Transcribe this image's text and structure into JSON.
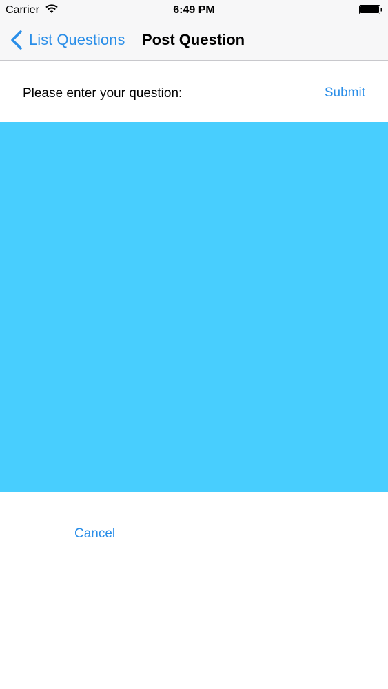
{
  "status_bar": {
    "carrier": "Carrier",
    "time": "6:49 PM",
    "icons": [
      "wifi-icon",
      "battery-icon"
    ]
  },
  "nav_bar": {
    "back_label": "List Questions",
    "back_icon": "chevron-left-icon",
    "title": "Post Question"
  },
  "form": {
    "prompt": "Please enter your question:",
    "submit_label": "Submit",
    "question_value": "",
    "cancel_label": "Cancel"
  },
  "colors": {
    "accent": "#2a8ee8",
    "input_background": "#48cefe",
    "bar_background": "#f7f7f8"
  }
}
